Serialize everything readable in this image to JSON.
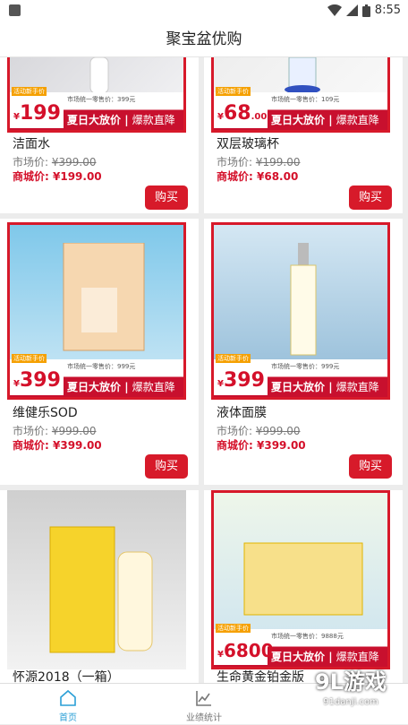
{
  "status": {
    "time": "8:55"
  },
  "title": "聚宝盆优购",
  "labels": {
    "market": "市场价:",
    "mall": "商城价:",
    "buy": "购买"
  },
  "banner": {
    "slogan_left": "夏日大放价",
    "slogan_right": "爆款直降",
    "tag": "活动新手价"
  },
  "products": [
    {
      "name": "洁面水",
      "banner_price": "199",
      "banner_cents": "",
      "unified": "市场统一零售价：399元",
      "market_price": "¥399.00",
      "mall_price": "¥199.00",
      "image": "cleanser-bottle"
    },
    {
      "name": "双层玻璃杯",
      "banner_price": "68",
      "banner_cents": ".00",
      "unified": "市场统一零售价：109元",
      "market_price": "¥199.00",
      "mall_price": "¥68.00",
      "image": "glass-cup"
    },
    {
      "name": "维健乐SOD",
      "banner_price": "399",
      "banner_cents": "",
      "unified": "市场统一零售价：999元",
      "market_price": "¥999.00",
      "mall_price": "¥399.00",
      "image": "sod-box"
    },
    {
      "name": "液体面膜",
      "banner_price": "399",
      "banner_cents": "",
      "unified": "市场统一零售价：999元",
      "market_price": "¥999.00",
      "mall_price": "¥399.00",
      "image": "serum-bottle"
    },
    {
      "name": "怀源2018（一箱）",
      "image": "liquor-box"
    },
    {
      "name": "生命黄金铂金版",
      "banner_price": "6800",
      "banner_cents": "",
      "unified": "市场统一零售价：9888元",
      "image": "gold-box"
    }
  ],
  "tabs": [
    {
      "label": "首页",
      "icon": "home-icon",
      "active": true
    },
    {
      "label": "业绩统计",
      "icon": "chart-icon",
      "active": false
    }
  ],
  "watermark": {
    "brand": "9L游戏",
    "url": "91danji.com"
  },
  "colors": {
    "accent": "#d71a2a",
    "tab_active": "#2a9fd6"
  }
}
